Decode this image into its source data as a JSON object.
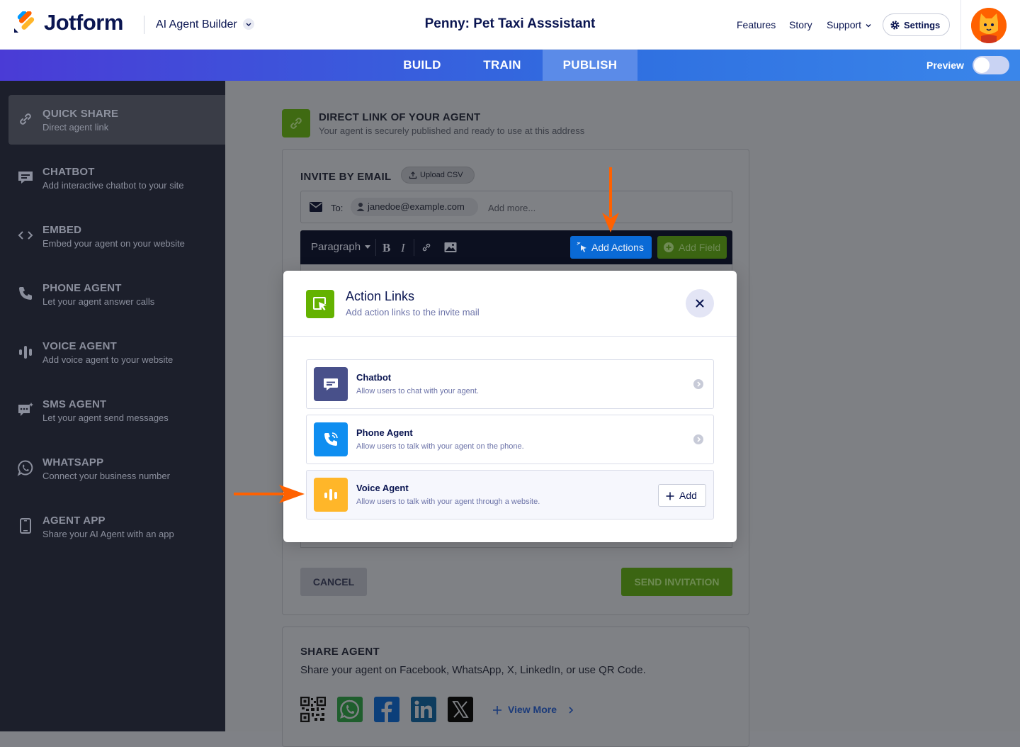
{
  "header": {
    "brand": "Jotform",
    "builder": "AI Agent Builder",
    "agent_title": "Penny: Pet Taxi Asssistant",
    "nav": [
      "Features",
      "Story",
      "Support"
    ],
    "settings_label": "Settings"
  },
  "tabs": [
    "BUILD",
    "TRAIN",
    "PUBLISH"
  ],
  "active_tab": "PUBLISH",
  "preview_label": "Preview",
  "sidebar": {
    "items": [
      {
        "title": "QUICK SHARE",
        "sub": "Direct agent link",
        "icon": "link-icon"
      },
      {
        "title": "CHATBOT",
        "sub": "Add interactive chatbot to your site",
        "icon": "chat-icon"
      },
      {
        "title": "EMBED",
        "sub": "Embed your agent on your website",
        "icon": "code-icon"
      },
      {
        "title": "PHONE AGENT",
        "sub": "Let your agent answer calls",
        "icon": "phone-icon"
      },
      {
        "title": "VOICE AGENT",
        "sub": "Add voice agent to your website",
        "icon": "voice-bars-icon"
      },
      {
        "title": "SMS AGENT",
        "sub": "Let your agent send messages",
        "icon": "sms-icon"
      },
      {
        "title": "WHATSAPP",
        "sub": "Connect your business number",
        "icon": "whatsapp-icon"
      },
      {
        "title": "AGENT APP",
        "sub": "Share your AI Agent with an app",
        "icon": "mobile-icon"
      }
    ]
  },
  "main": {
    "direct_title": "DIRECT LINK OF YOUR AGENT",
    "direct_sub": "Your agent is securely published and ready to use at this address",
    "invite_title": "INVITE BY EMAIL",
    "upload_csv": "Upload CSV",
    "to_label": "To:",
    "email_chip": "janedoe@example.com",
    "add_more": "Add more...",
    "paragraph": "Paragraph",
    "add_actions": "Add Actions",
    "add_field": "Add Field",
    "cancel": "CANCEL",
    "send": "SEND INVITATION",
    "share_title": "SHARE AGENT",
    "share_sub": "Share your agent on Facebook, WhatsApp, X, LinkedIn, or use QR Code.",
    "view_more": "View More"
  },
  "modal": {
    "title": "Action Links",
    "subtitle": "Add action links to the invite mail",
    "options": [
      {
        "title": "Chatbot",
        "sub": "Allow users to chat with your agent.",
        "color": "#48508a"
      },
      {
        "title": "Phone Agent",
        "sub": "Allow users to talk with your agent on the phone.",
        "color": "#0f8ef0"
      },
      {
        "title": "Voice Agent",
        "sub": "Allow users to talk with your agent through a website.",
        "color": "#ffb629"
      }
    ],
    "add_label": "Add"
  },
  "colors": {
    "accent": "#0a6ad6",
    "annotation": "#ff6100",
    "brand_green": "#64b200"
  }
}
